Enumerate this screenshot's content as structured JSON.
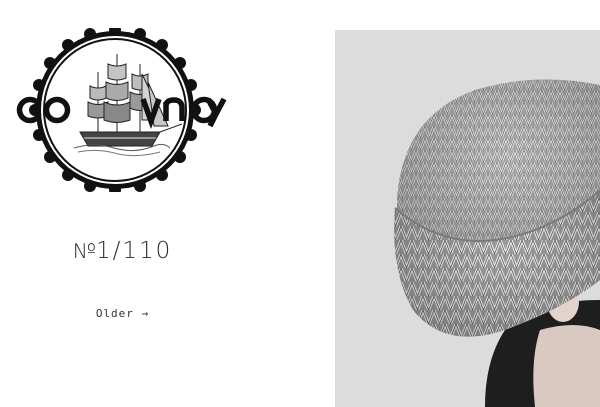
{
  "logo": {
    "letters": [
      "C",
      "O",
      "N",
      "V",
      "O",
      "Y"
    ],
    "icon": "ship-icon"
  },
  "issue": {
    "prefix": "№",
    "number": "1/110"
  },
  "nav": {
    "older_label": "Older →"
  },
  "photo": {
    "icon": "knit-beanie-photo"
  },
  "colors": {
    "background": "#ffffff",
    "text": "#222222",
    "photo_background": "#dedede"
  }
}
